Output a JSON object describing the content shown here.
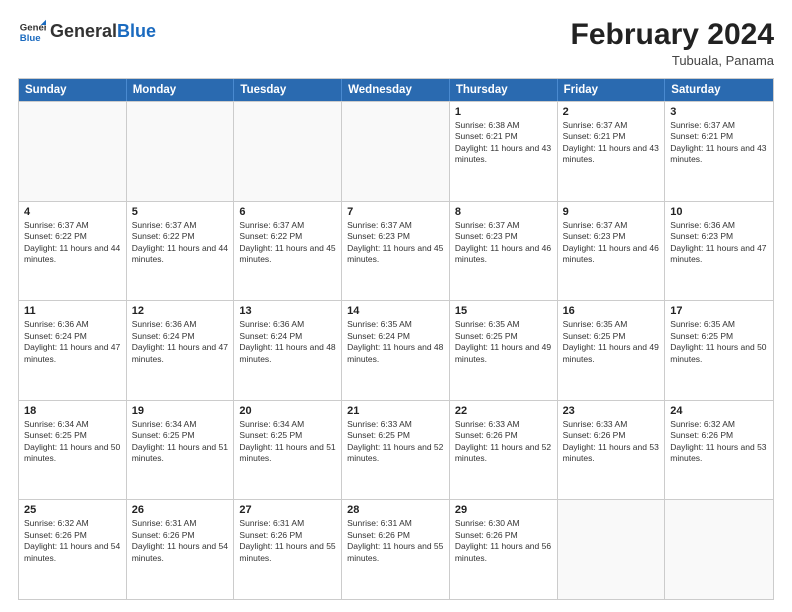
{
  "header": {
    "logo": {
      "general": "General",
      "blue": "Blue"
    },
    "title": "February 2024",
    "location": "Tubuala, Panama"
  },
  "weekdays": [
    "Sunday",
    "Monday",
    "Tuesday",
    "Wednesday",
    "Thursday",
    "Friday",
    "Saturday"
  ],
  "rows": [
    [
      {
        "day": "",
        "info": ""
      },
      {
        "day": "",
        "info": ""
      },
      {
        "day": "",
        "info": ""
      },
      {
        "day": "",
        "info": ""
      },
      {
        "day": "1",
        "info": "Sunrise: 6:38 AM\nSunset: 6:21 PM\nDaylight: 11 hours and 43 minutes."
      },
      {
        "day": "2",
        "info": "Sunrise: 6:37 AM\nSunset: 6:21 PM\nDaylight: 11 hours and 43 minutes."
      },
      {
        "day": "3",
        "info": "Sunrise: 6:37 AM\nSunset: 6:21 PM\nDaylight: 11 hours and 43 minutes."
      }
    ],
    [
      {
        "day": "4",
        "info": "Sunrise: 6:37 AM\nSunset: 6:22 PM\nDaylight: 11 hours and 44 minutes."
      },
      {
        "day": "5",
        "info": "Sunrise: 6:37 AM\nSunset: 6:22 PM\nDaylight: 11 hours and 44 minutes."
      },
      {
        "day": "6",
        "info": "Sunrise: 6:37 AM\nSunset: 6:22 PM\nDaylight: 11 hours and 45 minutes."
      },
      {
        "day": "7",
        "info": "Sunrise: 6:37 AM\nSunset: 6:23 PM\nDaylight: 11 hours and 45 minutes."
      },
      {
        "day": "8",
        "info": "Sunrise: 6:37 AM\nSunset: 6:23 PM\nDaylight: 11 hours and 46 minutes."
      },
      {
        "day": "9",
        "info": "Sunrise: 6:37 AM\nSunset: 6:23 PM\nDaylight: 11 hours and 46 minutes."
      },
      {
        "day": "10",
        "info": "Sunrise: 6:36 AM\nSunset: 6:23 PM\nDaylight: 11 hours and 47 minutes."
      }
    ],
    [
      {
        "day": "11",
        "info": "Sunrise: 6:36 AM\nSunset: 6:24 PM\nDaylight: 11 hours and 47 minutes."
      },
      {
        "day": "12",
        "info": "Sunrise: 6:36 AM\nSunset: 6:24 PM\nDaylight: 11 hours and 47 minutes."
      },
      {
        "day": "13",
        "info": "Sunrise: 6:36 AM\nSunset: 6:24 PM\nDaylight: 11 hours and 48 minutes."
      },
      {
        "day": "14",
        "info": "Sunrise: 6:35 AM\nSunset: 6:24 PM\nDaylight: 11 hours and 48 minutes."
      },
      {
        "day": "15",
        "info": "Sunrise: 6:35 AM\nSunset: 6:25 PM\nDaylight: 11 hours and 49 minutes."
      },
      {
        "day": "16",
        "info": "Sunrise: 6:35 AM\nSunset: 6:25 PM\nDaylight: 11 hours and 49 minutes."
      },
      {
        "day": "17",
        "info": "Sunrise: 6:35 AM\nSunset: 6:25 PM\nDaylight: 11 hours and 50 minutes."
      }
    ],
    [
      {
        "day": "18",
        "info": "Sunrise: 6:34 AM\nSunset: 6:25 PM\nDaylight: 11 hours and 50 minutes."
      },
      {
        "day": "19",
        "info": "Sunrise: 6:34 AM\nSunset: 6:25 PM\nDaylight: 11 hours and 51 minutes."
      },
      {
        "day": "20",
        "info": "Sunrise: 6:34 AM\nSunset: 6:25 PM\nDaylight: 11 hours and 51 minutes."
      },
      {
        "day": "21",
        "info": "Sunrise: 6:33 AM\nSunset: 6:25 PM\nDaylight: 11 hours and 52 minutes."
      },
      {
        "day": "22",
        "info": "Sunrise: 6:33 AM\nSunset: 6:26 PM\nDaylight: 11 hours and 52 minutes."
      },
      {
        "day": "23",
        "info": "Sunrise: 6:33 AM\nSunset: 6:26 PM\nDaylight: 11 hours and 53 minutes."
      },
      {
        "day": "24",
        "info": "Sunrise: 6:32 AM\nSunset: 6:26 PM\nDaylight: 11 hours and 53 minutes."
      }
    ],
    [
      {
        "day": "25",
        "info": "Sunrise: 6:32 AM\nSunset: 6:26 PM\nDaylight: 11 hours and 54 minutes."
      },
      {
        "day": "26",
        "info": "Sunrise: 6:31 AM\nSunset: 6:26 PM\nDaylight: 11 hours and 54 minutes."
      },
      {
        "day": "27",
        "info": "Sunrise: 6:31 AM\nSunset: 6:26 PM\nDaylight: 11 hours and 55 minutes."
      },
      {
        "day": "28",
        "info": "Sunrise: 6:31 AM\nSunset: 6:26 PM\nDaylight: 11 hours and 55 minutes."
      },
      {
        "day": "29",
        "info": "Sunrise: 6:30 AM\nSunset: 6:26 PM\nDaylight: 11 hours and 56 minutes."
      },
      {
        "day": "",
        "info": ""
      },
      {
        "day": "",
        "info": ""
      }
    ]
  ]
}
